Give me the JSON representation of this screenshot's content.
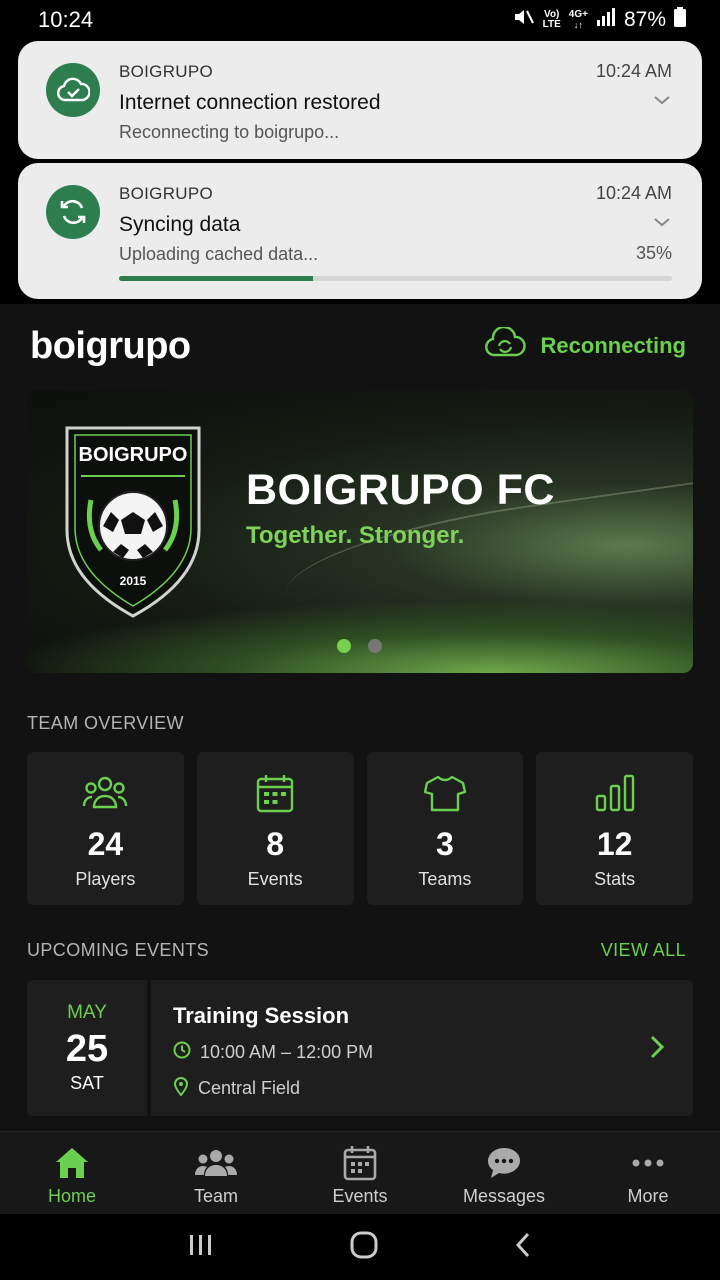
{
  "status_bar": {
    "time": "10:24",
    "net_top": "Vo)",
    "net_bottom": "LTE",
    "signal_top": "4G+",
    "battery": "87%"
  },
  "notifications": [
    {
      "app": "BOIGRUPO",
      "time": "10:24 AM",
      "title": "Internet connection restored",
      "body": "Reconnecting to boigrupo..."
    },
    {
      "app": "BOIGRUPO",
      "time": "10:24 AM",
      "title": "Syncing data",
      "body": "Uploading cached data...",
      "progress_label": "35%",
      "progress": 0.35
    }
  ],
  "header": {
    "logo": "boigrupo",
    "status": "Reconnecting"
  },
  "banner": {
    "crest_name": "BOIGRUPO",
    "crest_year": "2015",
    "title": "BOIGRUPO FC",
    "subtitle": "Together. Stronger.",
    "active_slide": 1,
    "slide_count": 2
  },
  "overview": {
    "title": "TEAM OVERVIEW",
    "cards": [
      {
        "icon": "users-icon",
        "value": "24",
        "label": "Players"
      },
      {
        "icon": "calendar-icon",
        "value": "8",
        "label": "Events"
      },
      {
        "icon": "jersey-icon",
        "value": "3",
        "label": "Teams"
      },
      {
        "icon": "bar-chart-icon",
        "value": "12",
        "label": "Stats"
      }
    ]
  },
  "upcoming": {
    "title": "UPCOMING EVENTS",
    "view_all": "VIEW ALL",
    "event": {
      "month": "MAY",
      "day": "25",
      "dow": "SAT",
      "title": "Training Session",
      "time": "10:00 AM – 12:00 PM",
      "location": "Central Field"
    }
  },
  "nav": [
    {
      "icon": "home-icon",
      "label": "Home",
      "active": true
    },
    {
      "icon": "team-icon",
      "label": "Team"
    },
    {
      "icon": "events-icon",
      "label": "Events"
    },
    {
      "icon": "messages-icon",
      "label": "Messages"
    },
    {
      "icon": "more-icon",
      "label": "More"
    }
  ],
  "colors": {
    "accent": "#6bcf4f",
    "background": "#121212",
    "card": "#1e1e1e",
    "notif_icon": "#2e7d4f"
  }
}
